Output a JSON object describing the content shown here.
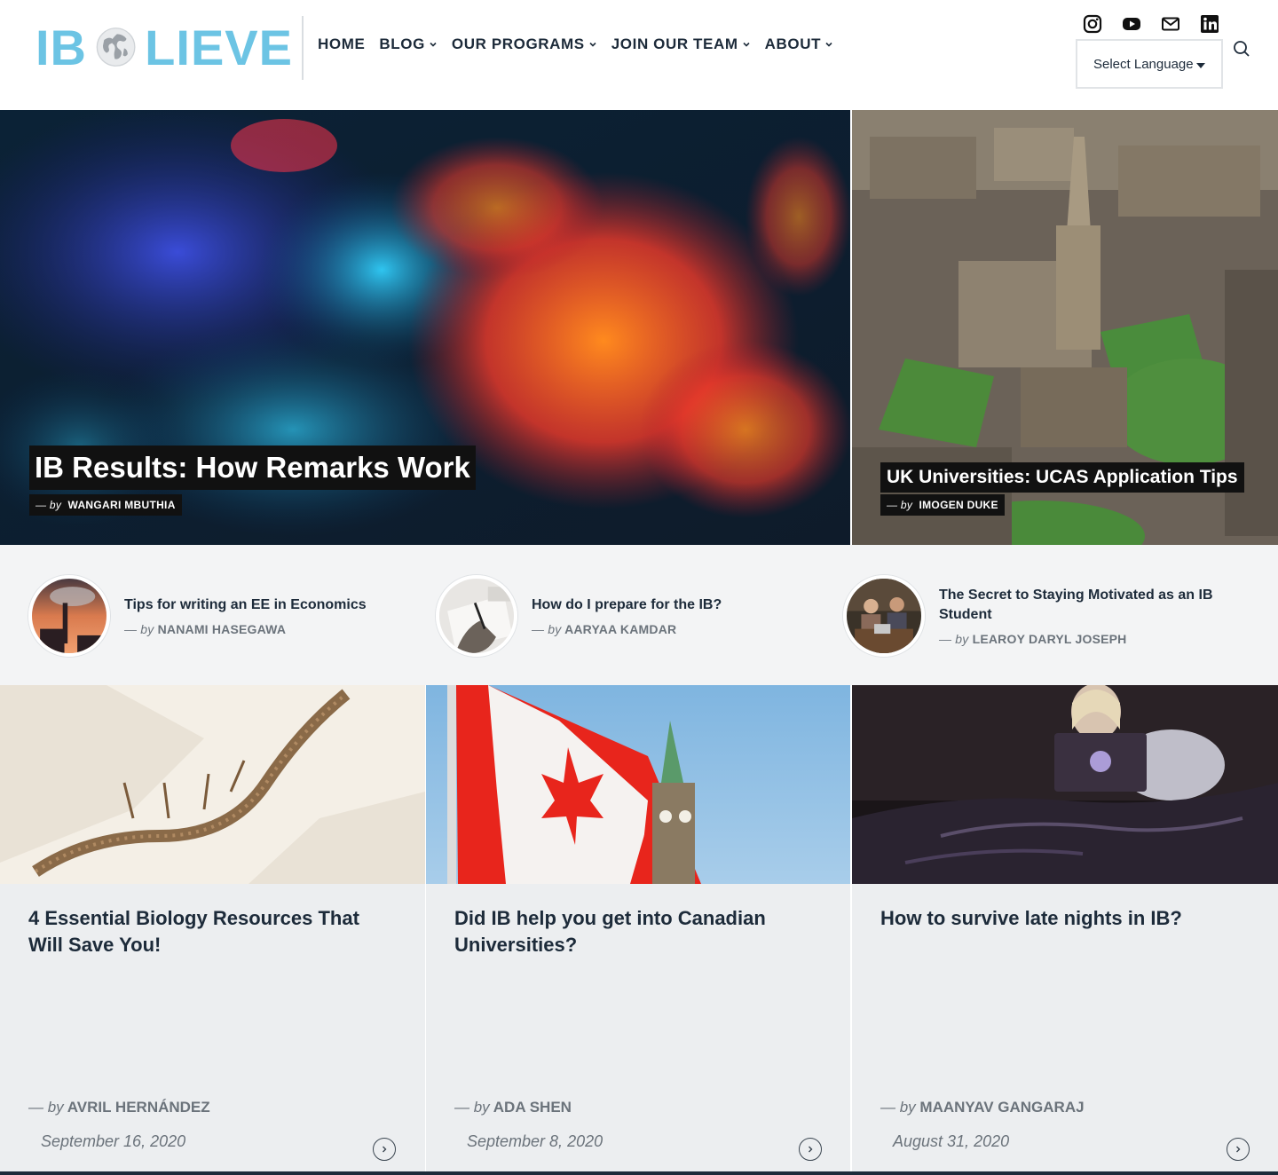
{
  "brand": {
    "part1": "IB",
    "part2": "LIEVE"
  },
  "nav": {
    "home": "HOME",
    "blog": "BLOG",
    "programs": "OUR PROGRAMS",
    "team": "JOIN OUR TEAM",
    "about": "ABOUT"
  },
  "language": {
    "label": "Select Language"
  },
  "social_icons": [
    "instagram-icon",
    "youtube-icon",
    "mail-icon",
    "linkedin-icon"
  ],
  "hero": [
    {
      "title": "IB Results: How Remarks Work",
      "by": "— by",
      "author": "WANGARI MBUTHIA"
    },
    {
      "title": "UK Universities: UCAS Application Tips",
      "by": "— by",
      "author": "IMOGEN DUKE"
    }
  ],
  "mini_posts": [
    {
      "title": "Tips for writing an EE in Economics",
      "by": "— by",
      "author": "NANAMI HASEGAWA"
    },
    {
      "title": "How do I prepare for the IB?",
      "by": "— by",
      "author": "AARYAA KAMDAR"
    },
    {
      "title": "The Secret to Staying Motivated as an IB Student",
      "by": "— by",
      "author": "LEAROY DARYL JOSEPH"
    }
  ],
  "cards": [
    {
      "title": "4 Essential Biology Resources That Will Save You!",
      "by": "— by",
      "author": "AVRIL HERNÁNDEZ",
      "date": "September 16, 2020"
    },
    {
      "title": "Did IB help you get into Canadian Universities?",
      "by": "— by",
      "author": "ADA SHEN",
      "date": "September 8, 2020"
    },
    {
      "title": "How to survive late nights in IB?",
      "by": "— by",
      "author": "MAANYAV GANGARAJ",
      "date": "August 31, 2020"
    }
  ],
  "colors": {
    "brand": "#6cc4e4",
    "text": "#1d2b3a",
    "muted": "#6b737b"
  }
}
